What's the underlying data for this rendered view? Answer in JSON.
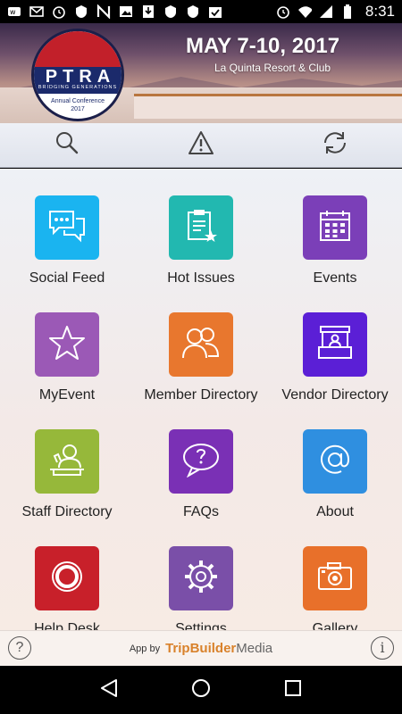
{
  "status_bar": {
    "time": "8:31",
    "left_icons": [
      "wp-icon",
      "gmail-icon",
      "alarm-icon",
      "vpn-icon",
      "n-icon",
      "image-icon",
      "download-icon",
      "vpn-icon",
      "vpn-icon",
      "checklist-icon"
    ],
    "right_icons": [
      "alarm-icon",
      "wifi-icon",
      "signal-icon",
      "battery-icon"
    ]
  },
  "banner": {
    "logo_text": "PTRA",
    "logo_tagline": "BRIDGING GENERATIONS",
    "logo_subtitle": "Annual Conference",
    "logo_year": "2017",
    "date": "MAY 7-10, 2017",
    "venue": "La Quinta Resort & Club"
  },
  "toolbar": {
    "buttons": [
      {
        "name": "search",
        "icon": "search-icon"
      },
      {
        "name": "alerts",
        "icon": "warning-icon"
      },
      {
        "name": "sync",
        "icon": "refresh-icon"
      }
    ]
  },
  "tiles": [
    {
      "label": "Social Feed",
      "icon": "chat-bubbles-icon",
      "color": "#1ab4f0"
    },
    {
      "label": "Hot Issues",
      "icon": "clipboard-star-icon",
      "color": "#22b8b0"
    },
    {
      "label": "Events",
      "icon": "calendar-icon",
      "color": "#7b3fb8"
    },
    {
      "label": "MyEvent",
      "icon": "star-icon",
      "color": "#9b59b6"
    },
    {
      "label": "Member Directory",
      "icon": "people-icon",
      "color": "#e8772e"
    },
    {
      "label": "Vendor Directory",
      "icon": "booth-icon",
      "color": "#5b1fd6"
    },
    {
      "label": "Staff Directory",
      "icon": "staff-desk-icon",
      "color": "#96b83a"
    },
    {
      "label": "FAQs",
      "icon": "question-bubble-icon",
      "color": "#7a30b5"
    },
    {
      "label": "About",
      "icon": "at-sign-icon",
      "color": "#2f8fe0"
    },
    {
      "label": "Help Desk",
      "icon": "lifebuoy-icon",
      "color": "#c8202a"
    },
    {
      "label": "Settings",
      "icon": "gear-icon",
      "color": "#7a4fa8"
    },
    {
      "label": "Gallery",
      "icon": "camera-icon",
      "color": "#e8702a"
    }
  ],
  "footer": {
    "help_label": "?",
    "info_label": "i",
    "credit_prefix": "App by",
    "credit_brand": "TripBuilder",
    "credit_brand_suffix": "Media"
  },
  "nav": {
    "buttons": [
      "back-icon",
      "home-icon",
      "recents-icon"
    ]
  }
}
